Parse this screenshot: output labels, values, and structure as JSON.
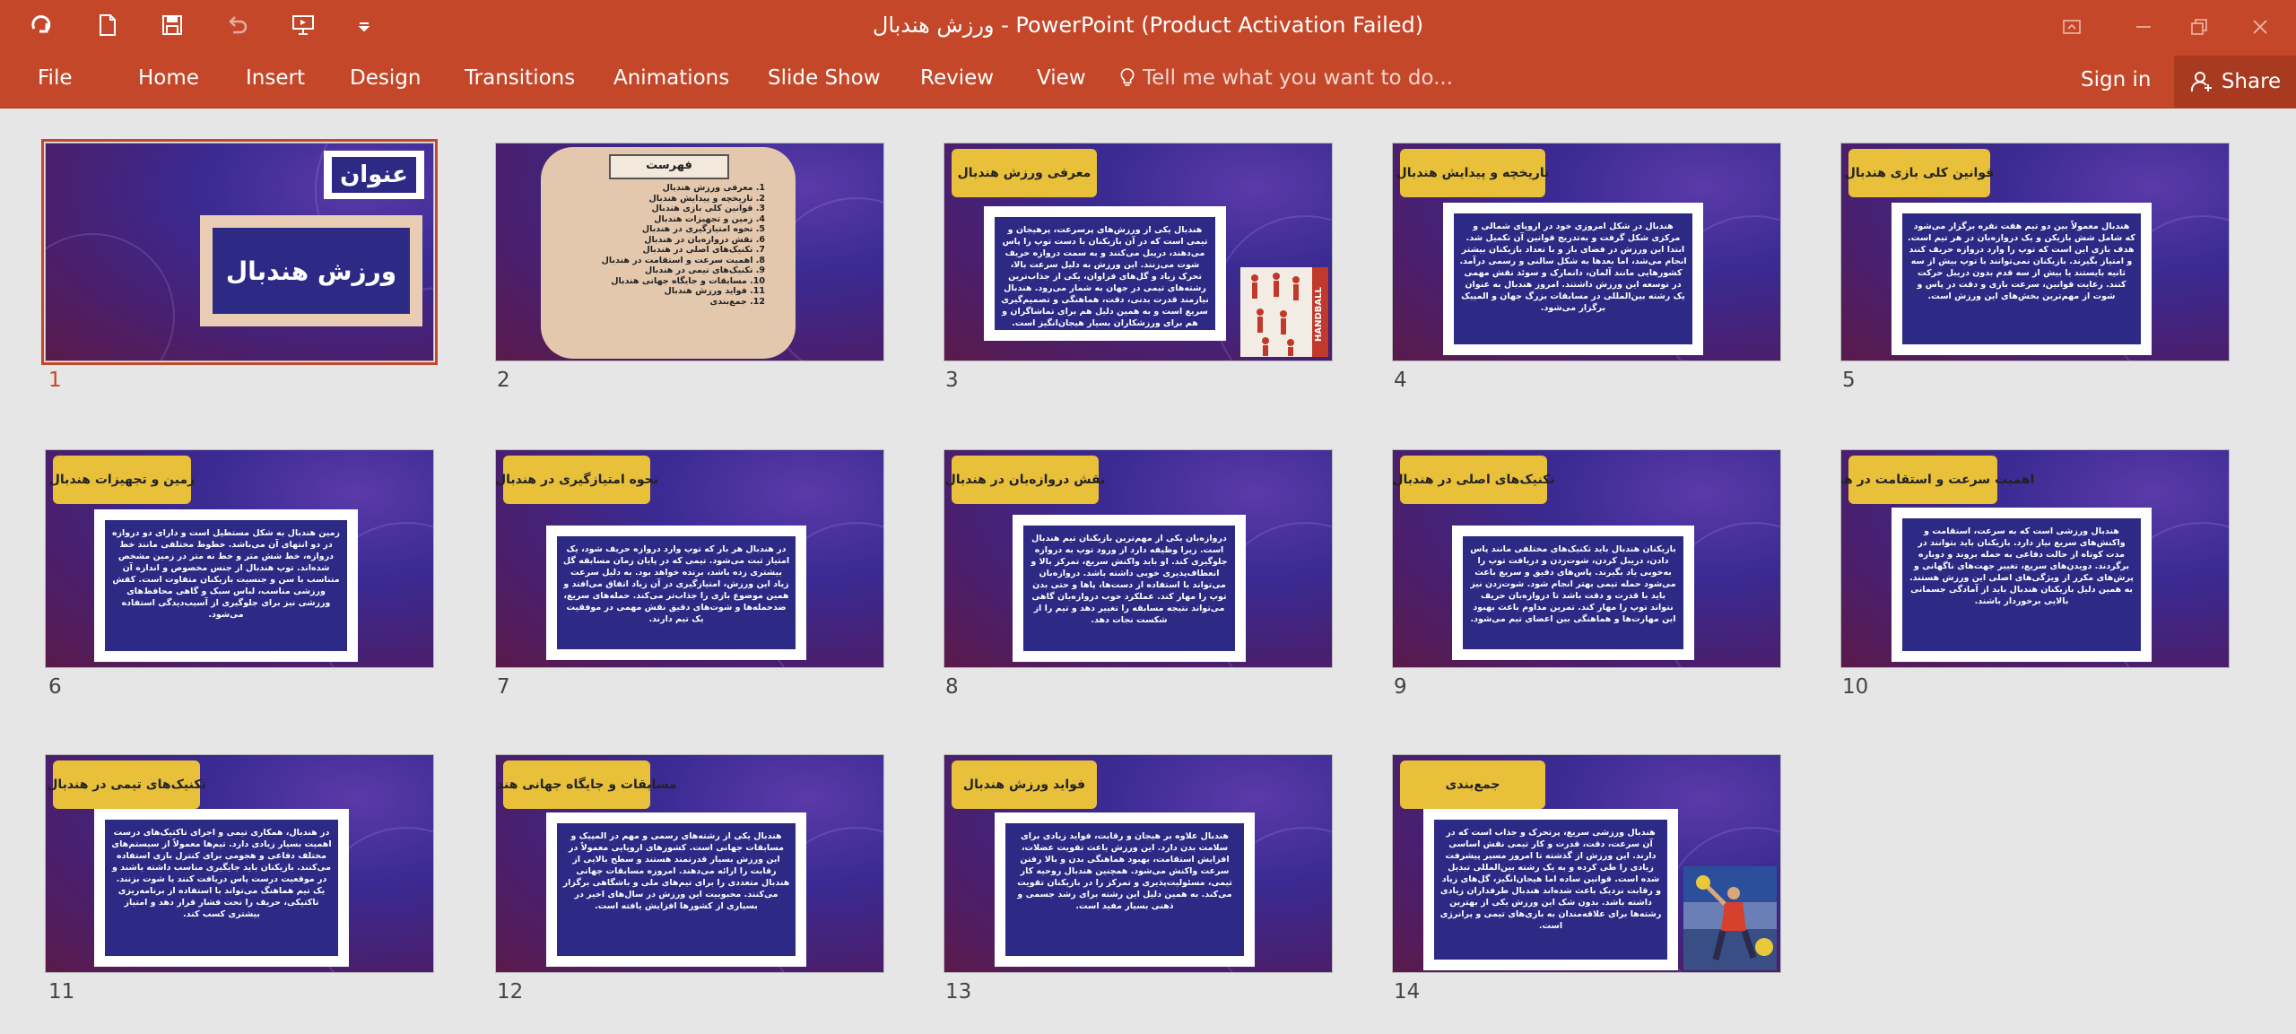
{
  "window": {
    "title": "ورزش هندبال  - PowerPoint (Product Activation Failed)"
  },
  "ribbon": {
    "tabs": [
      "File",
      "Home",
      "Insert",
      "Design",
      "Transitions",
      "Animations",
      "Slide Show",
      "Review",
      "View"
    ],
    "tell_me": "Tell me what you want to do...",
    "sign_in": "Sign in",
    "share": "Share"
  },
  "colors": {
    "ribbon_bg": "#c4472a",
    "slide_title_box": "#e8c03a",
    "content_box": "#2d2a86",
    "selection": "#c4472a"
  },
  "slides": [
    {
      "number": "1",
      "layout": "title",
      "selected": true,
      "heading": "عنوان",
      "title": "ورزش هندبال"
    },
    {
      "number": "2",
      "layout": "toc",
      "heading": "فهرست",
      "items": [
        "1.    معرفی ورزش هندبال",
        "2.    تاریخچه و پیدایش هندبال",
        "3.    قوانین کلی بازی هندبال",
        "4.    زمین و تجهیزات هندبال",
        "5.    نحوه امتیازگیری در هندبال",
        "6.    نقش دروازه‌بان در هندبال",
        "7.    تکنیک‌های اصلی در هندبال",
        "8.    اهمیت سرعت و استقامت در هندبال",
        "9.    تکنیک‌های تیمی در هندبال",
        "10.    مسابقات و جایگاه جهانی هندبال",
        "11.    فواید ورزش هندبال",
        "12.    جمع‌بندی"
      ]
    },
    {
      "number": "3",
      "layout": "content-image",
      "title": "معرفی ورزش هندبال",
      "body": "هندبال یکی از ورزش‌های پرسرعت، پرهیجان و تیمی است که در آن بازیکنان با دست توپ را پاس می‌دهند، دریبل می‌کنند و به سمت دروازه حریف شوت می‌زنند. این ورزش به دلیل سرعت بالا، تحرک زیاد و گل‌های فراوان، یکی از جذاب‌ترین رشته‌های تیمی در جهان به شمار می‌رود. هندبال نیازمند قدرت بدنی، دقت، هماهنگی و تصمیم‌گیری سریع است و به همین دلیل هم برای تماشاگران و هم برای ورزشکاران بسیار هیجان‌انگیز است.",
      "image_label": "HANDBALL"
    },
    {
      "number": "4",
      "layout": "content",
      "title": "تاریخچه و پیدایش هندبال",
      "body": "هندبال در شکل امروزی خود در اروپای شمالی و مرکزی شکل گرفت و به‌تدریج قوانین آن تکمیل شد. ابتدا این ورزش در فضای باز و با تعداد بازیکنان بیشتر انجام می‌شد، اما بعدها به شکل سالنی و رسمی درآمد. کشورهایی مانند آلمان، دانمارک و سوئد نقش مهمی در توسعه این ورزش داشتند. امروز هندبال به عنوان یک رشته بین‌المللی در مسابقات بزرگ جهان و المپیک برگزار می‌شود."
    },
    {
      "number": "5",
      "layout": "content",
      "title": "قوانین کلی بازی هندبال",
      "body": "هندبال معمولاً بین دو تیم هفت نفره برگزار می‌شود که شامل شش بازیکن و یک دروازه‌بان در هر تیم است. هدف بازی این است که توپ را وارد دروازه حریف کنند و امتیاز بگیرند. بازیکنان نمی‌توانند با توپ بیش از سه ثانیه بایستند یا بیش از سه قدم بدون دریبل حرکت کنند. رعایت قوانین، سرعت بازی و دقت در پاس و شوت از مهم‌ترین بخش‌های این ورزش است."
    },
    {
      "number": "6",
      "layout": "content",
      "title": "زمین و تجهیزات هندبال",
      "body": "زمین هندبال به شکل مستطیل است و دارای دو دروازه در دو انتهای آن می‌باشد. خطوط مختلفی مانند خط دروازه، خط شش متر و خط نه متر در زمین مشخص شده‌اند. توپ هندبال از جنس مخصوص و اندازه آن متناسب با سن و جنسیت بازیکنان متفاوت است. کفش ورزشی مناسب، لباس سبک و گاهی محافظ‌های ورزشی نیز برای جلوگیری از آسیب‌دیدگی استفاده می‌شود."
    },
    {
      "number": "7",
      "layout": "content",
      "title": "نحوه امتیازگیری در هندبال",
      "body": "در هندبال هر بار که توپ وارد دروازه حریف شود، یک امتیاز ثبت می‌شود. تیمی که در پایان زمان مسابقه گل بیشتری زده باشد، برنده خواهد بود. به دلیل سرعت زیاد این ورزش، امتیازگیری در آن زیاد اتفاق می‌افتد و همین موضوع بازی را جذاب‌تر می‌کند. حمله‌های سریع، ضدحمله‌ها و شوت‌های دقیق نقش مهمی در موفقیت یک تیم دارند."
    },
    {
      "number": "8",
      "layout": "content",
      "title": "نقش دروازه‌بان در هندبال",
      "body": "دروازه‌بان یکی از مهم‌ترین بازیکنان تیم هندبال است. زیرا وظیفه دارد از ورود توپ به دروازه جلوگیری کند. او باید واکنش سریع، تمرکز بالا و انعطاف‌پذیری خوبی داشته باشد. دروازه‌بان می‌تواند با استفاده از دست‌ها، پاها و حتی بدن توپ را مهار کند. عملکرد خوب دروازه‌بان گاهی می‌تواند نتیجه مسابقه را تغییر دهد و تیم را از شکست نجات دهد."
    },
    {
      "number": "9",
      "layout": "content",
      "title": "تکنیک‌های اصلی در هندبال",
      "body": "بازیکنان هندبال باید تکنیک‌های مختلفی مانند پاس دادن، دریبل کردن، شوت‌زدن و دریافت توپ را به‌خوبی یاد بگیرند. پاس‌های دقیق و سریع باعث می‌شود حمله تیمی بهتر انجام شود. شوت‌زدن نیز باید با قدرت و دقت باشد تا دروازه‌بان حریف نتواند توپ را مهار کند. تمرین مداوم باعث بهبود این مهارت‌ها و هماهنگی بین اعضای تیم می‌شود."
    },
    {
      "number": "10",
      "layout": "content",
      "title": "اهمیت سرعت و استقامت در هندبال",
      "body": "هندبال ورزشی است که به سرعت، استقامت و واکنش‌های سریع نیاز دارد. بازیکنان باید بتوانند در مدت کوتاه از حالت دفاعی به حمله بروند و دوباره برگردند. دویدن‌های سریع، تغییر جهت‌های ناگهانی و پرش‌های مکرر از ویژگی‌های اصلی این ورزش هستند. به همین دلیل بازیکنان هندبال باید از آمادگی جسمانی بالایی برخوردار باشند."
    },
    {
      "number": "11",
      "layout": "content",
      "title": "تکنیک‌های تیمی در هندبال",
      "body": "در هندبال، همکاری تیمی و اجرای تاکتیک‌های درست اهمیت بسیار زیادی دارد. تیم‌ها معمولاً از سیستم‌های مختلف دفاعی و هجومی برای کنترل بازی استفاده می‌کنند. بازیکنان باید جایگیری مناسب داشته باشند و در موقعیت درست پاس دریافت کنند یا شوت بزنند. یک تیم هماهنگ می‌تواند با استفاده از برنامه‌ریزی تاکتیکی، حریف را تحت فشار قرار دهد و امتیاز بیشتری کسب کند."
    },
    {
      "number": "12",
      "layout": "content",
      "title": "مسابقات و جایگاه جهانی هندبال",
      "body": "هندبال یکی از رشته‌های رسمی و مهم در المپیک و مسابقات جهانی است. کشورهای اروپایی معمولاً در این ورزش بسیار قدرتمند هستند و سطح بالایی از رقابت را ارائه می‌دهند. امروزه مسابقات جهانی هندبال متعددی را برای تیم‌های ملی و باشگاهی برگزار می‌کنند. محبوبیت این ورزش در سال‌های اخیر در بسیاری از کشورها افزایش یافته است."
    },
    {
      "number": "13",
      "layout": "content",
      "title": "فواید ورزش هندبال",
      "body": "هندبال علاوه بر هیجان و رقابت، فواید زیادی برای سلامت بدن دارد. این ورزش باعث تقویت عضلات، افزایش استقامت، بهبود هماهنگی بدن و بالا رفتن سرعت واکنش می‌شود. همچنین هندبال روحیه کار تیمی، مسئولیت‌پذیری و تمرکز را در بازیکنان تقویت می‌کند. به همین دلیل این رشته برای رشد جسمی و ذهنی بسیار مفید است."
    },
    {
      "number": "14",
      "layout": "content-image",
      "title": "جمع‌بندی",
      "body": "هندبال ورزشی سریع، پرتحرک و جذاب است که در آن سرعت، دقت، قدرت و کار تیمی نقش اساسی دارند. این ورزش از گذشته تا امروز مسیر پیشرفت زیادی را طی کرده و به یک رشته بین‌المللی تبدیل شده است. قوانین ساده اما هیجان‌انگیز، گل‌های زیاد و رقابت نزدیک باعث شده‌اند هندبال طرفداران زیادی داشته باشد. بدون شک این ورزش یکی از بهترین رشته‌ها برای علاقه‌مندان به بازی‌های تیمی و پرانرژی است."
    }
  ]
}
